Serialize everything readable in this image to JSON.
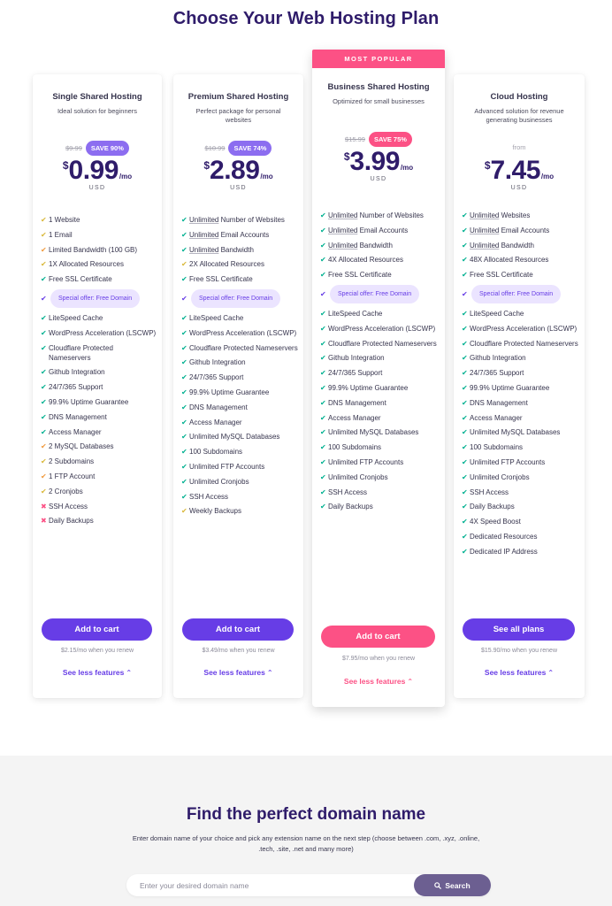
{
  "page": {
    "title": "Choose Your Web Hosting Plan"
  },
  "colors": {
    "primary": "#673de6",
    "accent": "#fc5185",
    "heading": "#2f1c6a",
    "check": "#00b090",
    "cross": "#fc5185"
  },
  "plans": [
    {
      "name": "Single Shared Hosting",
      "description": "Ideal solution for beginners",
      "old_price": "$9.99",
      "save_badge": "SAVE 90%",
      "currency": "$",
      "amount": "0.99",
      "per": "/mo",
      "unit": "USD",
      "features": [
        {
          "text": "1 Website",
          "status": "partial"
        },
        {
          "text": "1 Email",
          "status": "partial"
        },
        {
          "text": "Limited Bandwidth (100 GB)",
          "status": "warn"
        },
        {
          "text": "1X Allocated Resources",
          "status": "partial"
        },
        {
          "text": "Free SSL Certificate",
          "status": "ok"
        },
        {
          "text": "Special offer: Free Domain",
          "status": "special"
        },
        {
          "text": "LiteSpeed Cache",
          "status": "ok"
        },
        {
          "text": "WordPress Acceleration (LSCWP)",
          "status": "ok"
        },
        {
          "text": "Cloudflare Protected Nameservers",
          "status": "ok"
        },
        {
          "text": "Github Integration",
          "status": "ok"
        },
        {
          "text": "24/7/365 Support",
          "status": "ok"
        },
        {
          "text": "99.9% Uptime Guarantee",
          "status": "ok"
        },
        {
          "text": "DNS Management",
          "status": "ok"
        },
        {
          "text": "Access Manager",
          "status": "ok"
        },
        {
          "text": "2 MySQL Databases",
          "status": "warn"
        },
        {
          "text": "2 Subdomains",
          "status": "partial"
        },
        {
          "text": "1 FTP Account",
          "status": "warn"
        },
        {
          "text": "2 Cronjobs",
          "status": "partial"
        },
        {
          "text": "SSH Access",
          "status": "no"
        },
        {
          "text": "Daily Backups",
          "status": "no"
        }
      ],
      "cta": "Add to cart",
      "renew": "$2.15/mo when you renew",
      "see_less": "See less features"
    },
    {
      "name": "Premium Shared Hosting",
      "description": "Perfect package for personal websites",
      "old_price": "$10.99",
      "save_badge": "SAVE 74%",
      "currency": "$",
      "amount": "2.89",
      "per": "/mo",
      "unit": "USD",
      "features": [
        {
          "prefix": "Unlimited",
          "text": " Number of Websites",
          "status": "ok"
        },
        {
          "prefix": "Unlimited",
          "text": " Email Accounts",
          "status": "ok"
        },
        {
          "prefix": "Unlimited",
          "text": " Bandwidth",
          "status": "ok"
        },
        {
          "text": "2X Allocated Resources",
          "status": "partial"
        },
        {
          "text": "Free SSL Certificate",
          "status": "ok"
        },
        {
          "text": "Special offer: Free Domain",
          "status": "special"
        },
        {
          "text": "LiteSpeed Cache",
          "status": "ok"
        },
        {
          "text": "WordPress Acceleration (LSCWP)",
          "status": "ok"
        },
        {
          "text": "Cloudflare Protected Nameservers",
          "status": "ok"
        },
        {
          "text": "Github Integration",
          "status": "ok"
        },
        {
          "text": "24/7/365 Support",
          "status": "ok"
        },
        {
          "text": "99.9% Uptime Guarantee",
          "status": "ok"
        },
        {
          "text": "DNS Management",
          "status": "ok"
        },
        {
          "text": "Access Manager",
          "status": "ok"
        },
        {
          "text": "Unlimited MySQL Databases",
          "status": "ok"
        },
        {
          "text": "100 Subdomains",
          "status": "ok"
        },
        {
          "text": "Unlimited FTP Accounts",
          "status": "ok"
        },
        {
          "text": "Unlimited Cronjobs",
          "status": "ok"
        },
        {
          "text": "SSH Access",
          "status": "ok"
        },
        {
          "text": "Weekly Backups",
          "status": "partial"
        }
      ],
      "cta": "Add to cart",
      "renew": "$3.49/mo when you renew",
      "see_less": "See less features"
    },
    {
      "ribbon": "MOST POPULAR",
      "name": "Business Shared Hosting",
      "description": "Optimized for small businesses",
      "old_price": "$15.99",
      "save_badge": "SAVE 75%",
      "currency": "$",
      "amount": "3.99",
      "per": "/mo",
      "unit": "USD",
      "features": [
        {
          "prefix": "Unlimited",
          "text": " Number of Websites",
          "status": "ok"
        },
        {
          "prefix": "Unlimited",
          "text": " Email Accounts",
          "status": "ok"
        },
        {
          "prefix": "Unlimited",
          "text": " Bandwidth",
          "status": "ok"
        },
        {
          "text": "4X Allocated Resources",
          "status": "ok"
        },
        {
          "text": "Free SSL Certificate",
          "status": "ok"
        },
        {
          "text": "Special offer: Free Domain",
          "status": "special"
        },
        {
          "text": "LiteSpeed Cache",
          "status": "ok"
        },
        {
          "text": "WordPress Acceleration (LSCWP)",
          "status": "ok"
        },
        {
          "text": "Cloudflare Protected Nameservers",
          "status": "ok"
        },
        {
          "text": "Github Integration",
          "status": "ok"
        },
        {
          "text": "24/7/365 Support",
          "status": "ok"
        },
        {
          "text": "99.9% Uptime Guarantee",
          "status": "ok"
        },
        {
          "text": "DNS Management",
          "status": "ok"
        },
        {
          "text": "Access Manager",
          "status": "ok"
        },
        {
          "text": "Unlimited MySQL Databases",
          "status": "ok"
        },
        {
          "text": "100 Subdomains",
          "status": "ok"
        },
        {
          "text": "Unlimited FTP Accounts",
          "status": "ok"
        },
        {
          "text": "Unlimited Cronjobs",
          "status": "ok"
        },
        {
          "text": "SSH Access",
          "status": "ok"
        },
        {
          "text": "Daily Backups",
          "status": "ok"
        }
      ],
      "cta": "Add to cart",
      "renew": "$7.95/mo when you renew",
      "see_less": "See less features"
    },
    {
      "name": "Cloud Hosting",
      "description": "Advanced solution for revenue generating businesses",
      "from_label": "from",
      "currency": "$",
      "amount": "7.45",
      "per": "/mo",
      "unit": "USD",
      "features": [
        {
          "prefix": "Unlimited",
          "text": " Websites",
          "status": "ok"
        },
        {
          "prefix": "Unlimited",
          "text": " Email Accounts",
          "status": "ok"
        },
        {
          "prefix": "Unlimited",
          "text": " Bandwidth",
          "status": "ok"
        },
        {
          "text": "48X Allocated Resources",
          "status": "ok"
        },
        {
          "text": "Free SSL Certificate",
          "status": "ok"
        },
        {
          "text": "Special offer: Free Domain",
          "status": "special"
        },
        {
          "text": "LiteSpeed Cache",
          "status": "ok"
        },
        {
          "text": "WordPress Acceleration (LSCWP)",
          "status": "ok"
        },
        {
          "text": "Cloudflare Protected Nameservers",
          "status": "ok"
        },
        {
          "text": "Github Integration",
          "status": "ok"
        },
        {
          "text": "24/7/365 Support",
          "status": "ok"
        },
        {
          "text": "99.9% Uptime Guarantee",
          "status": "ok"
        },
        {
          "text": "DNS Management",
          "status": "ok"
        },
        {
          "text": "Access Manager",
          "status": "ok"
        },
        {
          "text": "Unlimited MySQL Databases",
          "status": "ok"
        },
        {
          "text": "100 Subdomains",
          "status": "ok"
        },
        {
          "text": "Unlimited FTP Accounts",
          "status": "ok"
        },
        {
          "text": "Unlimited Cronjobs",
          "status": "ok"
        },
        {
          "text": "SSH Access",
          "status": "ok"
        },
        {
          "text": "Daily Backups",
          "status": "ok"
        },
        {
          "text": "4X Speed Boost",
          "status": "ok"
        },
        {
          "text": "Dedicated Resources",
          "status": "ok"
        },
        {
          "text": "Dedicated IP Address",
          "status": "ok"
        }
      ],
      "cta": "See all plans",
      "renew": "$15.90/mo when you renew",
      "see_less": "See less features"
    }
  ],
  "icons": {
    "ok": "check-icon",
    "partial": "check-icon",
    "warn": "check-icon",
    "special": "check-icon",
    "no": "cross-icon",
    "chevron": "chevron-up-icon",
    "search": "search-icon"
  },
  "domain": {
    "title": "Find the perfect domain name",
    "description": "Enter domain name of your choice and pick any extension name on the next step (choose between .com, .xyz, .online, .tech, .site, .net and many more)",
    "input_placeholder": "Enter your desired domain name",
    "input_value": "",
    "search_label": "Search"
  }
}
